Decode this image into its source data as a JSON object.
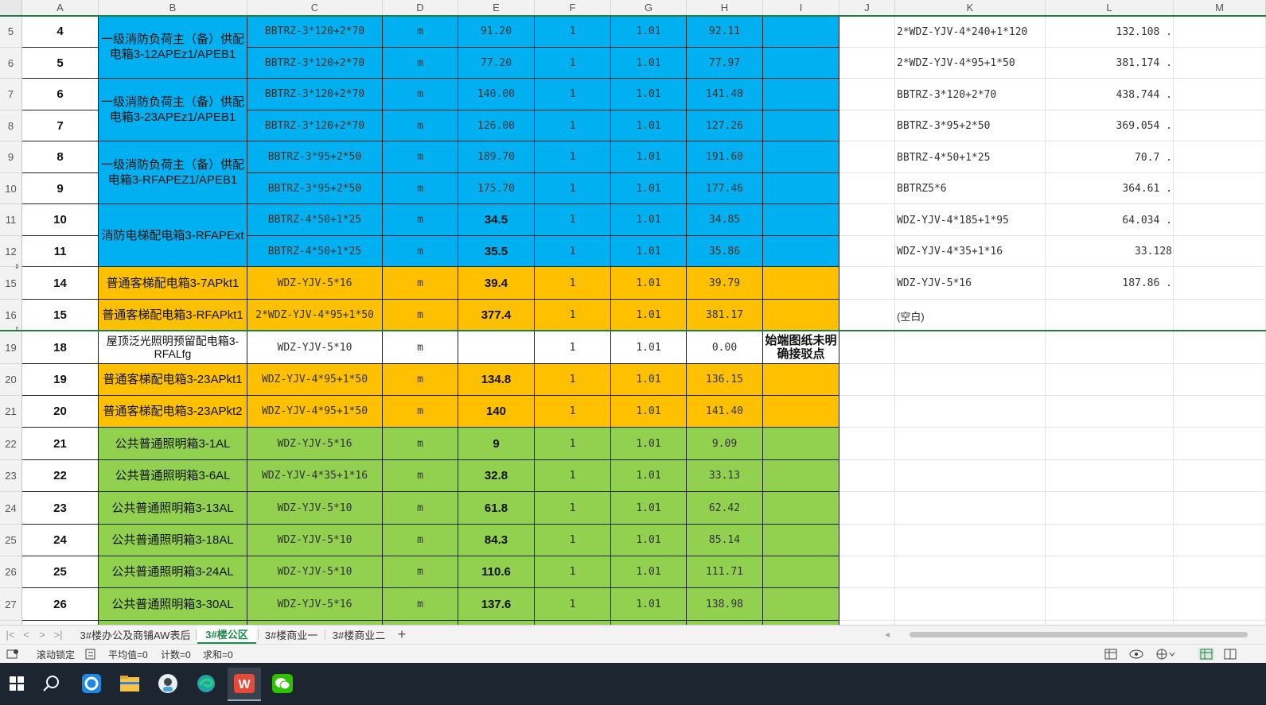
{
  "columns": [
    "A",
    "B",
    "C",
    "D",
    "E",
    "F",
    "G",
    "H",
    "I",
    "J",
    "K",
    "L",
    "M"
  ],
  "rows_top": [
    {
      "rn": "5",
      "no": "4",
      "cable": "BBTRZ-3*120+2*70",
      "unit": "m",
      "len": "91.20",
      "qty": "1",
      "coef": "1.01",
      "total": "92.11",
      "note": ""
    },
    {
      "rn": "6",
      "no": "5",
      "cable": "BBTRZ-3*120+2*70",
      "unit": "m",
      "len": "77.20",
      "qty": "1",
      "coef": "1.01",
      "total": "77.97",
      "note": ""
    },
    {
      "rn": "7",
      "no": "6",
      "cable": "BBTRZ-3*120+2*70",
      "unit": "m",
      "len": "140.00",
      "qty": "1",
      "coef": "1.01",
      "total": "141.40",
      "note": ""
    },
    {
      "rn": "8",
      "no": "7",
      "cable": "BBTRZ-3*120+2*70",
      "unit": "m",
      "len": "126.00",
      "qty": "1",
      "coef": "1.01",
      "total": "127.26",
      "note": ""
    },
    {
      "rn": "9",
      "no": "8",
      "cable": "BBTRZ-3*95+2*50",
      "unit": "m",
      "len": "189.70",
      "qty": "1",
      "coef": "1.01",
      "total": "191.60",
      "note": ""
    },
    {
      "rn": "10",
      "no": "9",
      "cable": "BBTRZ-3*95+2*50",
      "unit": "m",
      "len": "175.70",
      "qty": "1",
      "coef": "1.01",
      "total": "177.46",
      "note": ""
    },
    {
      "rn": "11",
      "no": "10",
      "cable": "BBTRZ-4*50+1*25",
      "unit": "m",
      "len": "34.5",
      "qty": "1",
      "coef": "1.01",
      "total": "34.85",
      "note": ""
    },
    {
      "rn": "12",
      "no": "11",
      "cable": "BBTRZ-4*50+1*25",
      "unit": "m",
      "len": "35.5",
      "qty": "1",
      "coef": "1.01",
      "total": "35.86",
      "note": ""
    },
    {
      "rn": "15",
      "no": "14",
      "cable": "WDZ-YJV-5*16",
      "unit": "m",
      "len": "39.4",
      "qty": "1",
      "coef": "1.01",
      "total": "39.79",
      "note": ""
    },
    {
      "rn": "16",
      "no": "15",
      "cable": "2*WDZ-YJV-4*95+1*50",
      "unit": "m",
      "len": "377.4",
      "qty": "1",
      "coef": "1.01",
      "total": "381.17",
      "note": ""
    }
  ],
  "rows_bottom": [
    {
      "rn": "19",
      "no": "18",
      "cable": "WDZ-YJV-5*10",
      "unit": "m",
      "len": "",
      "qty": "1",
      "coef": "1.01",
      "total": "0.00",
      "note": "始端图纸未明确接驳点"
    },
    {
      "rn": "20",
      "no": "19",
      "cable": "WDZ-YJV-4*95+1*50",
      "unit": "m",
      "len": "134.8",
      "qty": "1",
      "coef": "1.01",
      "total": "136.15",
      "note": ""
    },
    {
      "rn": "21",
      "no": "20",
      "cable": "WDZ-YJV-4*95+1*50",
      "unit": "m",
      "len": "140",
      "qty": "1",
      "coef": "1.01",
      "total": "141.40",
      "note": ""
    },
    {
      "rn": "22",
      "no": "21",
      "cable": "WDZ-YJV-5*16",
      "unit": "m",
      "len": "9",
      "qty": "1",
      "coef": "1.01",
      "total": "9.09",
      "note": ""
    },
    {
      "rn": "23",
      "no": "22",
      "cable": "WDZ-YJV-4*35+1*16",
      "unit": "m",
      "len": "32.8",
      "qty": "1",
      "coef": "1.01",
      "total": "33.13",
      "note": ""
    },
    {
      "rn": "24",
      "no": "23",
      "cable": "WDZ-YJV-5*10",
      "unit": "m",
      "len": "61.8",
      "qty": "1",
      "coef": "1.01",
      "total": "62.42",
      "note": ""
    },
    {
      "rn": "25",
      "no": "24",
      "cable": "WDZ-YJV-5*10",
      "unit": "m",
      "len": "84.3",
      "qty": "1",
      "coef": "1.01",
      "total": "85.14",
      "note": ""
    },
    {
      "rn": "26",
      "no": "25",
      "cable": "WDZ-YJV-5*10",
      "unit": "m",
      "len": "110.6",
      "qty": "1",
      "coef": "1.01",
      "total": "111.71",
      "note": ""
    },
    {
      "rn": "27",
      "no": "26",
      "cable": "WDZ-YJV-5*16",
      "unit": "m",
      "len": "137.6",
      "qty": "1",
      "coef": "1.01",
      "total": "138.98",
      "note": ""
    }
  ],
  "names_top": [
    "一级消防负荷主（备）供配电箱3-12APEz1/APEB1",
    "一级消防负荷主（备）供配电箱3-23APEz1/APEB1",
    "一级消防负荷主（备）供配电箱3-RFAPEZ1/APEB1",
    "消防电梯配电箱3-RFAPExt",
    "普通客梯配电箱3-7APkt1",
    "普通客梯配电箱3-RFAPkt1"
  ],
  "names_bottom": [
    "屋顶泛光照明预留配电箱3-RFALfg",
    "普通客梯配电箱3-23APkt1",
    "普通客梯配电箱3-23APkt2",
    "公共普通照明箱3-1AL",
    "公共普通照明箱3-6AL",
    "公共普通照明箱3-13AL",
    "公共普通照明箱3-18AL",
    "公共普通照明箱3-24AL",
    "公共普通照明箱3-30AL"
  ],
  "pivot": [
    {
      "k": "2*WDZ-YJV-4*240+1*120",
      "l": "132.108"
    },
    {
      "k": "2*WDZ-YJV-4*95+1*50",
      "l": "381.174"
    },
    {
      "k": "BBTRZ-3*120+2*70",
      "l": "438.744"
    },
    {
      "k": "BBTRZ-3*95+2*50",
      "l": "369.054"
    },
    {
      "k": "BBTRZ-4*50+1*25",
      "l": "70.7"
    },
    {
      "k": "BBTRZ5*6",
      "l": "364.61"
    },
    {
      "k": "WDZ-YJV-4*185+1*95",
      "l": "64.034"
    },
    {
      "k": "WDZ-YJV-4*35+1*16",
      "l": "33.128"
    },
    {
      "k": "WDZ-YJV-5*16",
      "l": "187.86"
    },
    {
      "k": "(空白)",
      "l": ""
    }
  ],
  "colors": {
    "blue": "#00b0f0",
    "orange": "#ffc000",
    "green": "#92d050",
    "freeze": "#1e7e45"
  },
  "tabs": [
    "3#楼办公及商铺AW表后",
    "3#楼公区",
    "3#楼商业一",
    "3#楼商业二"
  ],
  "active_tab": "3#楼公区",
  "status": {
    "scroll_lock": "滚动锁定",
    "avg": "平均值=0",
    "count": "计数=0",
    "sum": "求和=0"
  }
}
